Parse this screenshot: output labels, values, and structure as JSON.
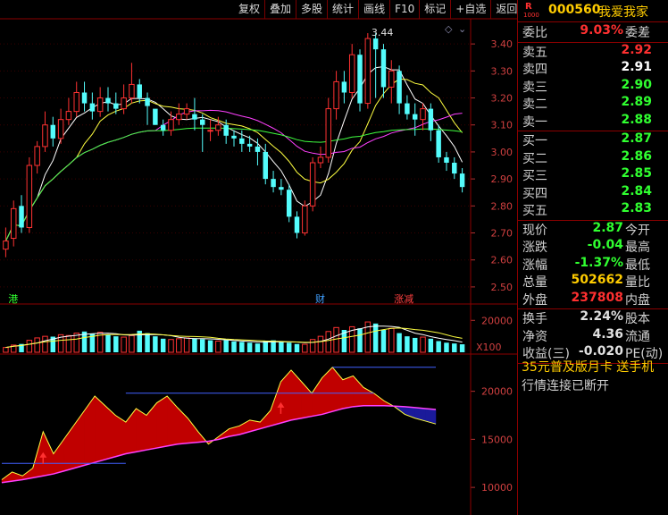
{
  "toolbar": [
    "复权",
    "叠加",
    "多股",
    "统计",
    "画线",
    "F10",
    "标记",
    "+自选",
    "返回"
  ],
  "stock": {
    "code": "000560",
    "name": "我爱我家",
    "logo_letter": "R",
    "logo_sub": "1000"
  },
  "quote": {
    "wei_bi": {
      "label": "委比",
      "value": "9.03%",
      "label2": "委差",
      "color": "#ff3030"
    },
    "asks": [
      {
        "label": "卖五",
        "price": "2.92",
        "color": "#ff3030"
      },
      {
        "label": "卖四",
        "price": "2.91",
        "color": "#ffffff"
      },
      {
        "label": "卖三",
        "price": "2.90",
        "color": "#30ff30"
      },
      {
        "label": "卖二",
        "price": "2.89",
        "color": "#30ff30"
      },
      {
        "label": "卖一",
        "price": "2.88",
        "color": "#30ff30"
      }
    ],
    "bids": [
      {
        "label": "买一",
        "price": "2.87",
        "color": "#30ff30"
      },
      {
        "label": "买二",
        "price": "2.86",
        "color": "#30ff30"
      },
      {
        "label": "买三",
        "price": "2.85",
        "color": "#30ff30"
      },
      {
        "label": "买四",
        "price": "2.84",
        "color": "#30ff30"
      },
      {
        "label": "买五",
        "price": "2.83",
        "color": "#30ff30"
      }
    ],
    "stats": [
      {
        "label": "现价",
        "value": "2.87",
        "label2": "今开",
        "color": "#30ff30"
      },
      {
        "label": "涨跌",
        "value": "-0.04",
        "label2": "最高",
        "color": "#30ff30"
      },
      {
        "label": "涨幅",
        "value": "-1.37%",
        "label2": "最低",
        "color": "#30ff30"
      },
      {
        "label": "总量",
        "value": "502662",
        "label2": "量比",
        "color": "#ffcc00"
      },
      {
        "label": "外盘",
        "value": "237808",
        "label2": "内盘",
        "color": "#ff3030"
      }
    ],
    "finance": [
      {
        "label": "换手",
        "value": "2.24%",
        "label2": "股本",
        "color": "#e0e0e0"
      },
      {
        "label": "净资",
        "value": "4.36",
        "label2": "流通",
        "color": "#e0e0e0"
      },
      {
        "label": "收益(三)",
        "value": "-0.020",
        "label2": "PE(动)",
        "color": "#e0e0e0"
      }
    ],
    "ad": "35元普及版月卡 送手机",
    "status": "行情连接已断开"
  },
  "chart_data": [
    {
      "type": "candlestick",
      "price_axis": [
        3.4,
        3.3,
        3.2,
        3.1,
        3.0,
        2.9,
        2.8,
        2.7,
        2.6,
        2.5
      ],
      "ylim": [
        2.45,
        3.47
      ],
      "high_label": "3.44",
      "markers": [
        {
          "text": "港",
          "index": 1,
          "color": "#30ff30"
        },
        {
          "text": "财",
          "index": 40,
          "color": "#40a0ff"
        },
        {
          "text": "涨减",
          "index": 50,
          "color": "#ff4040"
        }
      ],
      "candles": [
        [
          2.64,
          2.67,
          2.72,
          2.61
        ],
        [
          2.68,
          2.79,
          2.82,
          2.65
        ],
        [
          2.8,
          2.72,
          2.84,
          2.7
        ],
        [
          2.72,
          2.95,
          2.98,
          2.7
        ],
        [
          2.95,
          3.02,
          3.04,
          2.92
        ],
        [
          3.02,
          3.1,
          3.15,
          3.0
        ],
        [
          3.1,
          3.05,
          3.13,
          3.02
        ],
        [
          3.05,
          3.12,
          3.16,
          3.03
        ],
        [
          3.12,
          3.15,
          3.2,
          3.1
        ],
        [
          3.15,
          3.22,
          3.26,
          3.13
        ],
        [
          3.22,
          3.18,
          3.26,
          3.15
        ],
        [
          3.18,
          3.15,
          3.22,
          3.12
        ],
        [
          3.15,
          3.2,
          3.24,
          3.13
        ],
        [
          3.2,
          3.18,
          3.24,
          3.15
        ],
        [
          3.18,
          3.16,
          3.22,
          3.14
        ],
        [
          3.16,
          3.2,
          3.25,
          3.14
        ],
        [
          3.2,
          3.25,
          3.33,
          3.18
        ],
        [
          3.25,
          3.2,
          3.27,
          3.18
        ],
        [
          3.2,
          3.17,
          3.22,
          3.1
        ],
        [
          3.16,
          3.1,
          3.15,
          3.1
        ],
        [
          3.1,
          3.08,
          3.12,
          3.06
        ],
        [
          3.08,
          3.12,
          3.15,
          3.06
        ],
        [
          3.12,
          3.14,
          3.18,
          3.1
        ],
        [
          3.14,
          3.16,
          3.18,
          3.12
        ],
        [
          3.14,
          3.12,
          3.2,
          3.08
        ],
        [
          3.12,
          3.1,
          3.14,
          3.0
        ],
        [
          3.08,
          3.08,
          3.12,
          3.04
        ],
        [
          3.08,
          3.1,
          3.13,
          3.06
        ],
        [
          3.1,
          3.06,
          3.12,
          3.03
        ],
        [
          3.06,
          3.05,
          3.08,
          3.02
        ],
        [
          3.05,
          3.03,
          3.08,
          3.0
        ],
        [
          3.03,
          3.02,
          3.06,
          3.0
        ],
        [
          3.02,
          3.0,
          3.05,
          2.95
        ],
        [
          3.0,
          2.9,
          3.03,
          2.88
        ],
        [
          2.9,
          2.87,
          2.93,
          2.85
        ],
        [
          2.87,
          2.86,
          2.9,
          2.84
        ],
        [
          2.86,
          2.76,
          2.88,
          2.74
        ],
        [
          2.76,
          2.7,
          2.78,
          2.68
        ],
        [
          2.7,
          2.8,
          2.82,
          2.69
        ],
        [
          2.8,
          2.96,
          2.98,
          2.78
        ],
        [
          2.96,
          2.98,
          3.02,
          2.94
        ],
        [
          2.98,
          3.16,
          3.2,
          2.96
        ],
        [
          3.16,
          3.26,
          3.3,
          3.12
        ],
        [
          3.26,
          3.22,
          3.3,
          3.18
        ],
        [
          3.22,
          3.36,
          3.4,
          3.2
        ],
        [
          3.36,
          3.18,
          3.38,
          3.15
        ],
        [
          3.18,
          3.42,
          3.44,
          3.16
        ],
        [
          3.42,
          3.38,
          3.44,
          3.2
        ],
        [
          3.38,
          3.24,
          3.4,
          3.2
        ],
        [
          3.24,
          3.3,
          3.34,
          3.18
        ],
        [
          3.3,
          3.18,
          3.32,
          3.14
        ],
        [
          3.18,
          3.14,
          3.21,
          3.12
        ],
        [
          3.14,
          3.12,
          3.18,
          3.06
        ],
        [
          3.12,
          3.16,
          3.18,
          3.08
        ],
        [
          3.16,
          3.08,
          3.18,
          3.04
        ],
        [
          3.08,
          2.98,
          3.1,
          2.96
        ],
        [
          2.98,
          2.96,
          3.0,
          2.93
        ],
        [
          2.96,
          2.92,
          2.98,
          2.9
        ],
        [
          2.92,
          2.87,
          2.94,
          2.85
        ]
      ]
    },
    {
      "type": "bar",
      "title": "volume",
      "axis_label": "20000",
      "multiplier": "X100",
      "ylim": [
        0,
        28000
      ],
      "values": [
        3000,
        4500,
        5200,
        7500,
        9000,
        10000,
        9800,
        11000,
        10500,
        12000,
        13000,
        11500,
        12500,
        11000,
        10000,
        9500,
        10500,
        13500,
        12000,
        10000,
        8500,
        8000,
        8500,
        9000,
        8800,
        8200,
        7500,
        7000,
        7500,
        6800,
        6500,
        6000,
        5500,
        7000,
        7500,
        6500,
        6000,
        5200,
        5000,
        8000,
        10000,
        13000,
        15500,
        14000,
        16000,
        15000,
        19000,
        18000,
        14000,
        15000,
        12000,
        10000,
        9000,
        9500,
        8500,
        7000,
        6000,
        5500,
        5000
      ],
      "colors": [
        "red",
        "red",
        "cyan",
        "red",
        "red",
        "red",
        "cyan",
        "red",
        "red",
        "red",
        "cyan",
        "cyan",
        "red",
        "cyan",
        "cyan",
        "red",
        "red",
        "cyan",
        "cyan",
        "cyan",
        "cyan",
        "red",
        "red",
        "red",
        "cyan",
        "cyan",
        "cyan",
        "red",
        "cyan",
        "cyan",
        "cyan",
        "cyan",
        "cyan",
        "cyan",
        "cyan",
        "cyan",
        "cyan",
        "cyan",
        "red",
        "red",
        "red",
        "red",
        "red",
        "cyan",
        "red",
        "cyan",
        "red",
        "cyan",
        "cyan",
        "red",
        "cyan",
        "cyan",
        "cyan",
        "red",
        "cyan",
        "cyan",
        "cyan",
        "cyan",
        "cyan"
      ]
    },
    {
      "type": "area",
      "ticks": [
        20000,
        15000,
        10000
      ],
      "ylim": [
        7500,
        23500
      ],
      "fast": [
        10800,
        11600,
        11200,
        12000,
        15800,
        13500,
        15000,
        16500,
        18000,
        19500,
        18500,
        17500,
        16800,
        18200,
        17500,
        18800,
        19500,
        18300,
        17200,
        15800,
        14500,
        15300,
        16100,
        16400,
        17000,
        16800,
        18000,
        21000,
        22200,
        21000,
        19800,
        21400,
        22500,
        21200,
        21600,
        20400,
        19800,
        19000,
        18400,
        17600,
        17200,
        16900,
        16600
      ],
      "slow": [
        10500,
        10650,
        10800,
        11000,
        11200,
        11400,
        11700,
        12000,
        12300,
        12600,
        12900,
        13200,
        13500,
        13700,
        13900,
        14100,
        14300,
        14500,
        14600,
        14700,
        14800,
        15000,
        15300,
        15500,
        15800,
        16100,
        16400,
        16700,
        17000,
        17200,
        17400,
        17600,
        17900,
        18200,
        18400,
        18500,
        18500,
        18500,
        18450,
        18400,
        18300,
        18200,
        18100
      ],
      "level_lines": [
        {
          "value": 12500,
          "from": 0,
          "to": 12
        },
        {
          "value": 19800,
          "from": 12,
          "to": 36
        },
        {
          "value": 22500,
          "from": 32,
          "to": 42
        }
      ],
      "arrows": [
        {
          "index": 4
        },
        {
          "index": 27
        }
      ]
    }
  ]
}
